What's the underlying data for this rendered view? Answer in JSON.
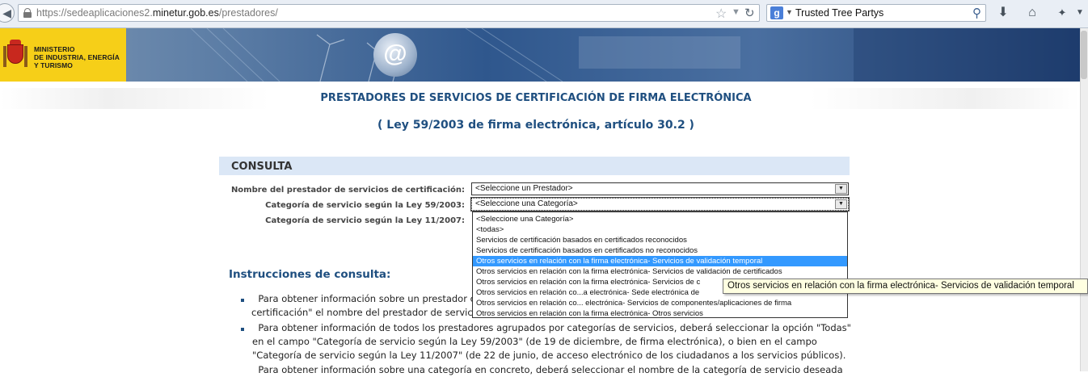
{
  "browser": {
    "url_prefix": "https://sedeaplicaciones2.",
    "url_domain": "minetur.gob.es",
    "url_path": "/prestadores/",
    "search_engine_letter": "g",
    "search_text": "Trusted Tree Partys",
    "icons": [
      "back-icon",
      "lock-icon",
      "star-icon",
      "reload-icon",
      "search-icon",
      "download-icon",
      "home-icon",
      "addon-icon",
      "menu-icon"
    ]
  },
  "banner": {
    "ministry_line1": "MINISTERIO",
    "ministry_line2": "DE INDUSTRIA, ENERGÍA",
    "ministry_line3": "Y TURISMO",
    "emblem": "@"
  },
  "page": {
    "title": "PRESTADORES DE SERVICIOS DE CERTIFICACIÓN DE FIRMA ELECTRÓNICA",
    "subtitle": "( Ley 59/2003 de firma electrónica, artículo 30.2 )"
  },
  "form": {
    "section_label": "CONSULTA",
    "field1_label": "Nombre del prestador de servicios de certificación:",
    "field1_value": "<Seleccione un Prestador>",
    "field2_label": "Categoría de servicio según la Ley 59/2003:",
    "field2_value": "<Seleccione una Categoría>",
    "field3_label": "Categoría de servicio según la Ley 11/2007:",
    "options": [
      "<Seleccione una Categoría>",
      "<todas>",
      "Servicios de certificación basados en certificados reconocidos",
      "Servicios de certificación basados en certificados no reconocidos",
      "Otros servicios en relación con la firma electrónica- Servicios de validación temporal",
      "Otros servicios en relación con la firma electrónica- Servicios de validación de certificados",
      "Otros servicios en relación con la firma electrónica- Servicios de c",
      "Otros servicios en relación co...a electrónica- Sede electrónica de",
      "Otros servicios en relación co... electrónica- Servicios de componentes/aplicaciones de firma",
      "Otros servicios en relación con la firma electrónica- Otros servicios"
    ],
    "selected_index": 4,
    "tooltip": "Otros servicios en relación con la firma electrónica- Servicios de validación temporal"
  },
  "instructions": {
    "title": "Instrucciones de consulta:",
    "p1_line1": "Para obtener información sobre un prestador c",
    "p1_line2": "certificación\" el nombre del prestador de servic",
    "p2_line1": "Para obtener información de todos los prestadores agrupados por categorías de servicios, deberá seleccionar la opción \"Todas\"",
    "p2_line2": "en el campo \"Categoría de servicio según la Ley 59/2003\" (de 19 de diciembre, de firma electrónica), o bien en el campo",
    "p2_line3": "\"Categoría de servicio según la Ley 11/2007\" (de 22 de junio, de acceso electrónico de los ciudadanos a los servicios públicos).",
    "p3_line1": "Para obtener información sobre una categoría en concreto, deberá seleccionar el nombre de la categoría de servicio deseada"
  }
}
